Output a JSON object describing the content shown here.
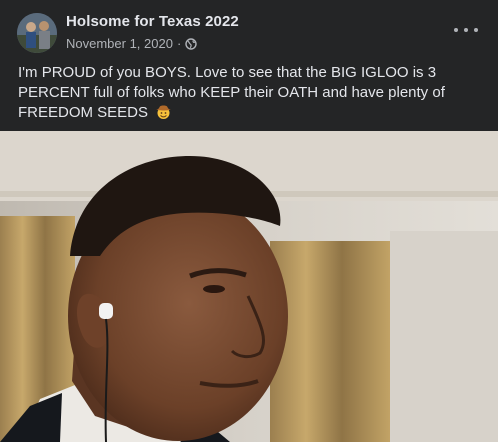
{
  "post": {
    "author": "Holsome for Texas 2022",
    "date": "November 1, 2020",
    "separator": "·",
    "audience_icon": "globe-icon",
    "more_icon": "more-options-icon",
    "text": "I'm PROUD of you BOYS. Love to see that the BIG IGLOO is 3 PERCENT full of folks who KEEP their OATH and have plenty of FREEDOM SEEDS",
    "emoji_icon": "cowboy-face-emoji"
  },
  "colors": {
    "card_bg": "#242526",
    "primary_text": "#e4e6eb",
    "secondary_text": "#b0b3b8"
  }
}
